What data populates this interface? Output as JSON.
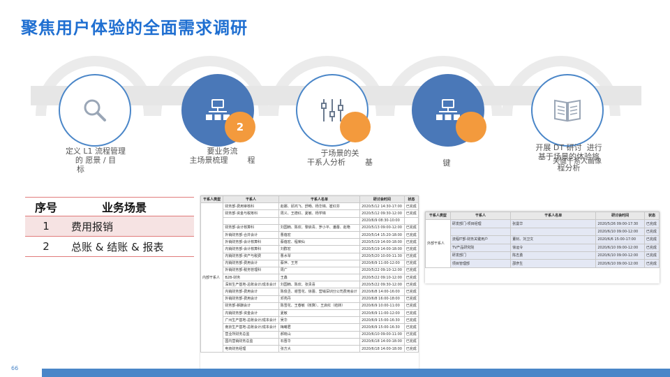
{
  "title": "聚焦用户体验的全面需求调研",
  "steps": [
    {
      "icon": "magnifier-icon",
      "badge": "",
      "lines": [
        "定义 L1 流程管理",
        "的 愿景 / 目",
        "标"
      ]
    },
    {
      "icon": "org-chart-icon",
      "badge": "2",
      "lines": [
        "要业务流",
        "主场景梳理        程"
      ]
    },
    {
      "icon": "sliders-icon",
      "badge": "",
      "lines": [
        "于场景的关",
        "干系人分析        基"
      ]
    },
    {
      "icon": "org-chart-icon",
      "badge": "",
      "lines": [
        "键"
      ]
    },
    {
      "icon": "book-icon",
      "badge": "",
      "lines": [
        "开展 DT 研讨  进行",
        "基于场景的体验旅",
        "关键干系人画像",
        "程分析"
      ]
    }
  ],
  "scenario_table": {
    "headers": [
      "序号",
      "业务场景"
    ],
    "rows": [
      {
        "no": "1",
        "name": "费用报销"
      },
      {
        "no": "2",
        "name": "总账 & 结账 & 报表"
      }
    ]
  },
  "internal_sheet": {
    "headers": [
      "干系人类型",
      "干系人",
      "干系人名单",
      "研讨会时间",
      "状态"
    ],
    "group": "内部干系人",
    "rows": [
      [
        "财务部-费用审核科",
        "赵娜、邱鸿飞、舒畅、杨华锦、崔红芬",
        "2020/5/12  14:30-17:00",
        "已完成"
      ],
      [
        "财务部-资金与税筹科",
        "周义、王德红、夏敏、杨学锦",
        "2020/5/12  09:30-12:00",
        "已完成"
      ],
      [
        "",
        "",
        "2020/6/9   08:30-10:00",
        ""
      ],
      [
        "财务部-会计核算科",
        "刘国楠、陈欢、黎启青、罗小平、潘蕾、赵艳",
        "2020/5/13  09:00-12:00",
        "已完成"
      ],
      [
        "外销财务部-合并会计",
        "曹蓓宏",
        "2020/5/14  15:20-18:00",
        "已完成"
      ],
      [
        "外销财务部-会计核算科",
        "蔡蓓宏、程荣仙",
        "2020/5/19  14:00-18:00",
        "已完成"
      ],
      [
        "内销财务部-会计核算科",
        "刘群宏",
        "2020/5/19  14:00-18:00",
        "已完成"
      ],
      [
        "内销财务部-资产与税费",
        "曹水琴",
        "2020/5/20  10:00-11:30",
        "已完成"
      ],
      [
        "内销财务部-费用会计",
        "蔡萍、王芳",
        "2020/6/9   11:00-12:00",
        "已完成"
      ],
      [
        "外销财务部-税务管理科",
        "周广",
        "2020/5/22  09:10-12:00",
        "已完成"
      ],
      [
        "B2B-财务",
        "王鑫",
        "2020/5/22  09:10-12:00",
        "已完成"
      ],
      [
        "深圳生产基地-总账会计/成本会计",
        "刘国楠、陈欢、张贵喜",
        "2020/5/22  09:30-12:00",
        "已完成"
      ],
      [
        "内销财务部-费用会计",
        "陈俊丞、谢雪花、徐蕾、营销深圳分公司费用会计",
        "2020/6/8   14:00-16:00",
        "已完成"
      ],
      [
        "外销财务部-费用会计",
        "邓亮丹",
        "2020/6/8   16:00-18:00",
        "已完成"
      ],
      [
        "财务部-薪酬会计",
        "陈雪花、王春敏（核算）、王启红（结转）",
        "2020/6/9   10:00-11:00",
        "已完成"
      ],
      [
        "内销财务部-资金会计",
        "夏敏",
        "2020/6/9   11:00-12:00",
        "已完成"
      ],
      [
        "广州生产基地-总账会计/成本会计",
        "吴华",
        "2020/6/9   15:00-16:30",
        "已完成"
      ],
      [
        "南京生产基地-总账会计/成本会计",
        "梅曦君",
        "2020/6/9   15:00-16:30",
        "已完成"
      ],
      [
        "营业所财务总监",
        "郝晓山",
        "2020/6/10  09:00-11:00",
        "已完成"
      ],
      [
        "国内营销财务总监",
        "石晋华",
        "2020/6/18  14:00-18:00",
        "已完成"
      ],
      [
        "电商财务经理",
        "张方大",
        "2020/6/18  14:00-18:00",
        "已完成"
      ]
    ]
  },
  "external_sheet": {
    "headers": [
      "干系人类型",
      "干系人",
      "干系人名单",
      "研讨会时间",
      "状态"
    ],
    "group": "外部干系人",
    "rows": [
      [
        "研发部门-项目经理",
        "张曼华",
        "2020/5/26  09:00-17:30",
        "已完成"
      ],
      [
        "",
        "",
        "2020/6/10  09:00-12:00",
        "已完成"
      ],
      [
        "流程IT部-财务关键用户",
        "董钊、刘卫文",
        "2020/6/6   15:00-17:00",
        "已完成"
      ],
      [
        "TV产品研究院",
        "徐运令",
        "2020/6/10  09:00-12:00",
        "已完成"
      ],
      [
        "研发部门",
        "陈志勇",
        "2020/6/10  09:00-12:00",
        "已完成"
      ],
      [
        "项目管理部",
        "邵彦生",
        "2020/6/10  09:00-12:00",
        "已完成"
      ]
    ]
  },
  "page_number": "66",
  "colors": {
    "title": "#1f6fd1",
    "node": "#4a78b8",
    "badge": "#f39a3d",
    "rule": "#e07b7b"
  }
}
